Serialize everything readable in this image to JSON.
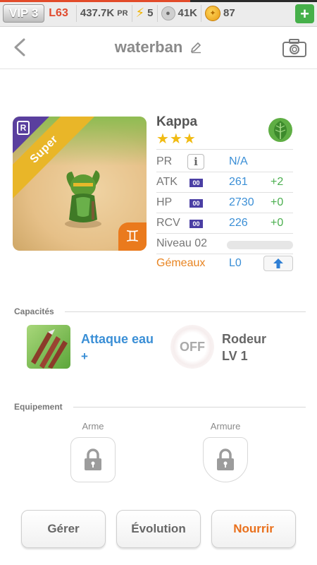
{
  "topbar": {
    "vip": "VIP 3",
    "level": "L63",
    "power": "437.7K",
    "power_unit": "PR",
    "energy": "5",
    "paws": "41K",
    "coins": "87",
    "add_icon": "plus-icon"
  },
  "header": {
    "title": "waterban",
    "back_icon": "chevron-left-icon",
    "edit_icon": "pencil-icon",
    "camera_icon": "camera-icon"
  },
  "monster": {
    "name": "Kappa",
    "stars": "★★★",
    "rarity": "Super",
    "rarity_badge": "R",
    "element_icon": "leaf-icon",
    "zodiac_icon": "gemini-icon",
    "stats": {
      "pr_label": "PR",
      "pr_value": "N/A",
      "atk_label": "ATK",
      "atk_value": "261",
      "atk_bonus": "+2",
      "hp_label": "HP",
      "hp_value": "2730",
      "hp_bonus": "+0",
      "rcv_label": "RCV",
      "rcv_value": "226",
      "rcv_bonus": "+0",
      "badge": "00",
      "level_label": "Niveau 02",
      "level_progress": 0,
      "constellation": "Gémeaux",
      "constellation_level": "L0"
    }
  },
  "abilities": {
    "section_title": "Capacités",
    "active_name": "Attaque eau",
    "active_plus": "+",
    "passive_state": "OFF",
    "passive_name": "Rodeur",
    "passive_level": "LV 1"
  },
  "equipment": {
    "section_title": "Equipement",
    "weapon_label": "Arme",
    "armor_label": "Armure"
  },
  "buttons": {
    "manage": "Gérer",
    "evolution": "Évolution",
    "feed": "Nourrir"
  }
}
